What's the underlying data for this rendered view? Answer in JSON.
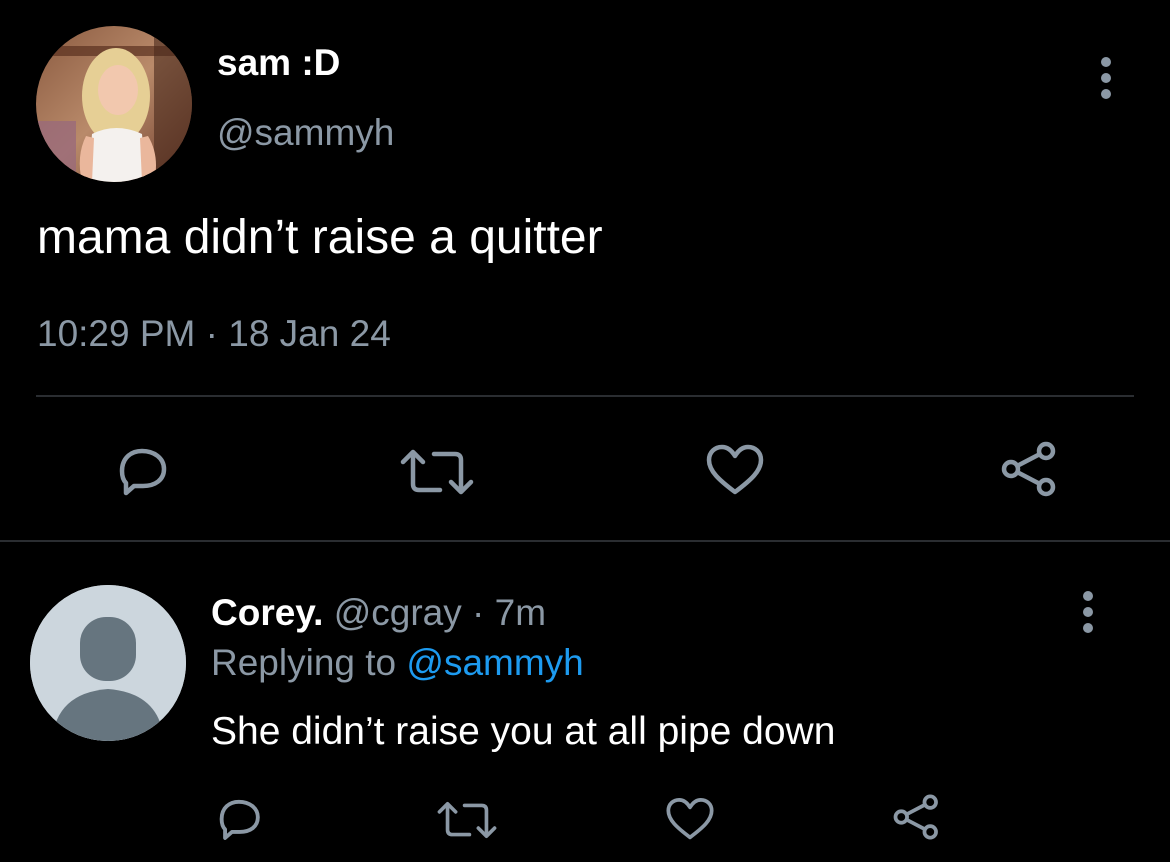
{
  "theme": {
    "background": "#000000",
    "text_primary": "#ffffff",
    "text_secondary": "#8b98a5",
    "link": "#1d9bf0",
    "divider": "#2a2d31"
  },
  "tweet": {
    "author": {
      "display_name": "sam :D",
      "handle": "@sammyh",
      "avatar": "profile-photo"
    },
    "text": "mama didn’t raise a quitter",
    "timestamp": "10:29 PM · 18 Jan 24",
    "more_icon": "more-vertical-icon",
    "actions": [
      {
        "name": "reply",
        "icon": "reply-icon"
      },
      {
        "name": "retweet",
        "icon": "retweet-icon"
      },
      {
        "name": "like",
        "icon": "heart-icon"
      },
      {
        "name": "share",
        "icon": "share-icon"
      }
    ]
  },
  "reply": {
    "author": {
      "display_name": "Corey.",
      "handle": "@cgray",
      "separator": "·",
      "age": "7m",
      "avatar": "default-avatar"
    },
    "replying_to_label": "Replying to",
    "replying_to_handle": "@sammyh",
    "text": "She didn’t raise you at all pipe down",
    "more_icon": "more-vertical-icon",
    "actions": [
      {
        "name": "reply",
        "icon": "reply-icon"
      },
      {
        "name": "retweet",
        "icon": "retweet-icon"
      },
      {
        "name": "like",
        "icon": "heart-icon"
      },
      {
        "name": "share",
        "icon": "share-icon"
      }
    ]
  }
}
